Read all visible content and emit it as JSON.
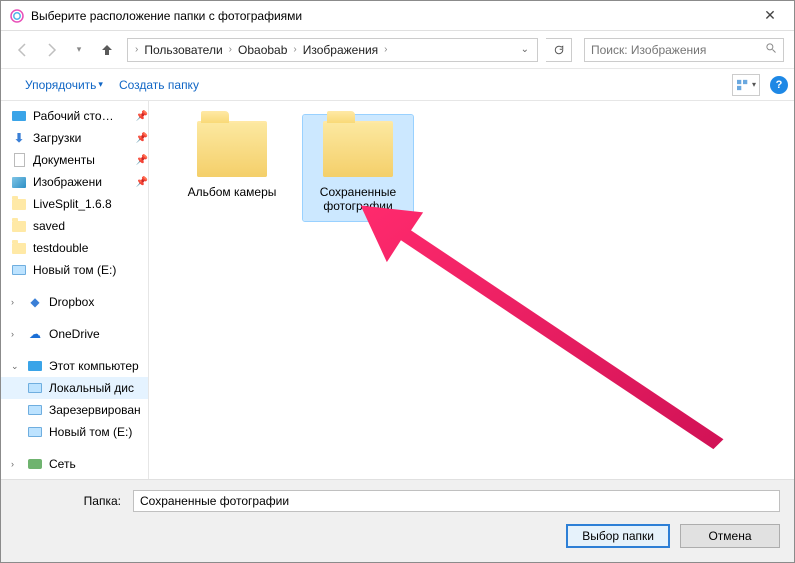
{
  "window": {
    "title": "Выберите расположение папки с фотографиями"
  },
  "breadcrumb": {
    "parts": [
      "Пользователи",
      "Obaobab",
      "Изображения"
    ]
  },
  "search": {
    "placeholder": "Поиск: Изображения"
  },
  "toolbar": {
    "organize": "Упорядочить",
    "new_folder": "Создать папку"
  },
  "sidebar": {
    "items": [
      {
        "label": "Рабочий сто…",
        "icon": "monitor",
        "pin": true
      },
      {
        "label": "Загрузки",
        "icon": "download",
        "pin": true
      },
      {
        "label": "Документы",
        "icon": "document",
        "pin": true
      },
      {
        "label": "Изображени",
        "icon": "pictures",
        "pin": true
      },
      {
        "label": "LiveSplit_1.6.8",
        "icon": "folder"
      },
      {
        "label": "saved",
        "icon": "folder"
      },
      {
        "label": "testdouble",
        "icon": "folder"
      },
      {
        "label": "Новый том (E:)",
        "icon": "drive"
      }
    ],
    "cloud": [
      {
        "label": "Dropbox",
        "icon": "dropbox"
      },
      {
        "label": "OneDrive",
        "icon": "onedrive"
      }
    ],
    "thispc": {
      "label": "Этот компьютер",
      "children": [
        {
          "label": "Локальный дис",
          "icon": "drive",
          "expanded": true
        },
        {
          "label": "Зарезервирован",
          "icon": "drive"
        },
        {
          "label": "Новый том (E:)",
          "icon": "drive"
        }
      ]
    },
    "network": {
      "label": "Сеть"
    }
  },
  "content": {
    "folders": [
      {
        "label": "Альбом камеры",
        "selected": false
      },
      {
        "label": "Сохраненные фотографии",
        "selected": true
      }
    ]
  },
  "footer": {
    "folder_label": "Папка:",
    "folder_value": "Сохраненные фотографии",
    "select_button": "Выбор папки",
    "cancel_button": "Отмена"
  }
}
